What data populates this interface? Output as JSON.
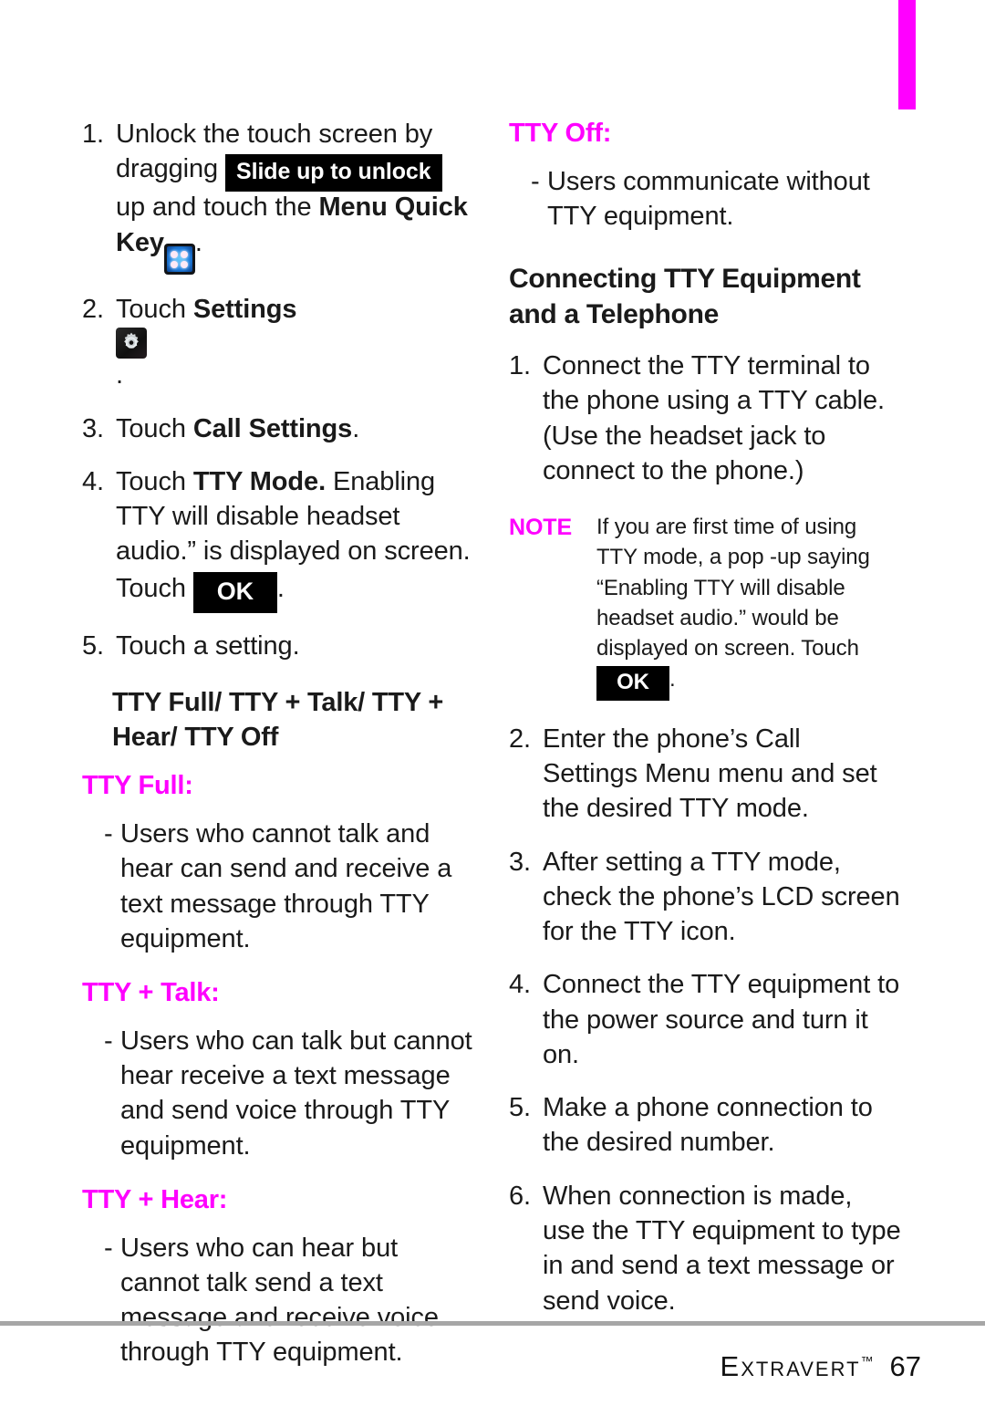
{
  "theme": {
    "accent_magenta": "#ff00ff",
    "badge_background": "#000000",
    "badge_text": "#ffffff",
    "body_text": "#1a1a1a",
    "footer_rule": "#a6a6a6"
  },
  "left_column": {
    "step1": {
      "number": "1.",
      "part_a": "Unlock the touch screen by dragging ",
      "badge_slide": "Slide up to unlock",
      "part_b": " up and touch the ",
      "bold_menu": "Menu Quick Key",
      "part_c": "."
    },
    "step2": {
      "number": "2.",
      "part_a": "Touch ",
      "bold": "Settings",
      "part_b": "."
    },
    "step3": {
      "number": "3.",
      "part_a": "Touch ",
      "bold": "Call Settings",
      "part_b": "."
    },
    "step4": {
      "number": "4.",
      "part_a": "Touch ",
      "bold": "TTY Mode.",
      "part_b": " Enabling TTY will disable headset audio.” is displayed on screen. Touch ",
      "badge_ok": "OK",
      "part_c": "."
    },
    "step5": {
      "number": "5.",
      "text": "Touch a setting."
    },
    "modes_heading": "TTY Full/ TTY + Talk/ TTY + Hear/ TTY Off",
    "sections": [
      {
        "heading": "TTY Full:",
        "dash": "-",
        "body": "Users who cannot  talk and hear can send and receive a text message through TTY equipment."
      },
      {
        "heading": "TTY + Talk:",
        "dash": "-",
        "body": "Users who can talk but cannot hear receive a text message and send voice through TTY equipment."
      },
      {
        "heading": "TTY + Hear:",
        "dash": "-",
        "body": "Users who can hear but cannot talk send a text message and receive voice through TTY equipment."
      }
    ]
  },
  "right_column": {
    "tty_off": {
      "heading": "TTY Off:",
      "dash": "-",
      "body": "Users communicate without TTY equipment."
    },
    "section_heading": "Connecting TTY Equipment and a Telephone",
    "steps_part1": [
      {
        "number": "1.",
        "text": "Connect the TTY terminal to the phone using a TTY cable. (Use the headset jack to connect to the phone.)"
      }
    ],
    "note": {
      "label": "NOTE",
      "part_a": "If you are first time of using TTY mode, a pop -up saying “Enabling TTY will disable headset audio.” would be  displayed on screen. Touch ",
      "badge_ok": "OK",
      "part_b": "."
    },
    "steps_part2": [
      {
        "number": "2.",
        "text": "Enter the phone’s Call Settings Menu menu and set the desired TTY mode."
      },
      {
        "number": "3.",
        "text": "After setting a TTY mode, check the phone’s LCD screen for the TTY icon."
      },
      {
        "number": "4.",
        "text": "Connect the TTY equipment to the power source and turn it on."
      },
      {
        "number": "5.",
        "text": "Make a phone connection to the desired number."
      },
      {
        "number": "6.",
        "text": "When connection is made, use the TTY equipment to type in and send a text message or send voice."
      }
    ]
  },
  "footer": {
    "brand": "Extravert",
    "trademark": "™",
    "page_number": "67"
  }
}
